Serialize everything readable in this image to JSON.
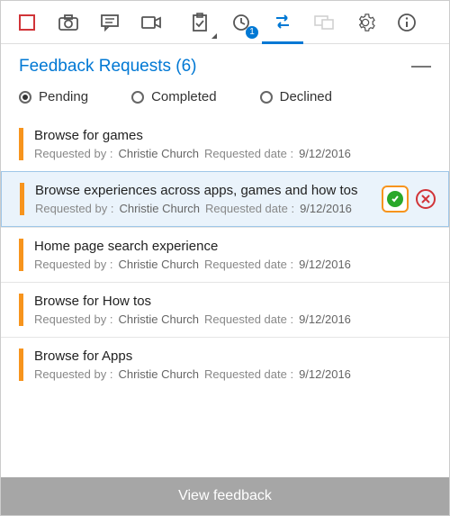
{
  "toolbar": {
    "badge_count": "1"
  },
  "header": {
    "title": "Feedback Requests (6)"
  },
  "filters": {
    "pending": "Pending",
    "completed": "Completed",
    "declined": "Declined",
    "selected": "pending"
  },
  "labels": {
    "requested_by": "Requested by :",
    "requested_date": "Requested date :"
  },
  "items": [
    {
      "title": "Browse for games",
      "requester": "Christie Church",
      "date": "9/12/2016",
      "selected": false
    },
    {
      "title": "Browse experiences across apps, games and how tos",
      "requester": "Christie Church",
      "date": "9/12/2016",
      "selected": true
    },
    {
      "title": "Home page search experience",
      "requester": "Christie Church",
      "date": "9/12/2016",
      "selected": false
    },
    {
      "title": "Browse for How tos",
      "requester": "Christie Church",
      "date": "9/12/2016",
      "selected": false
    },
    {
      "title": "Browse for Apps",
      "requester": "Christie Church",
      "date": "9/12/2016",
      "selected": false
    }
  ],
  "footer": {
    "view_feedback": "View feedback"
  }
}
